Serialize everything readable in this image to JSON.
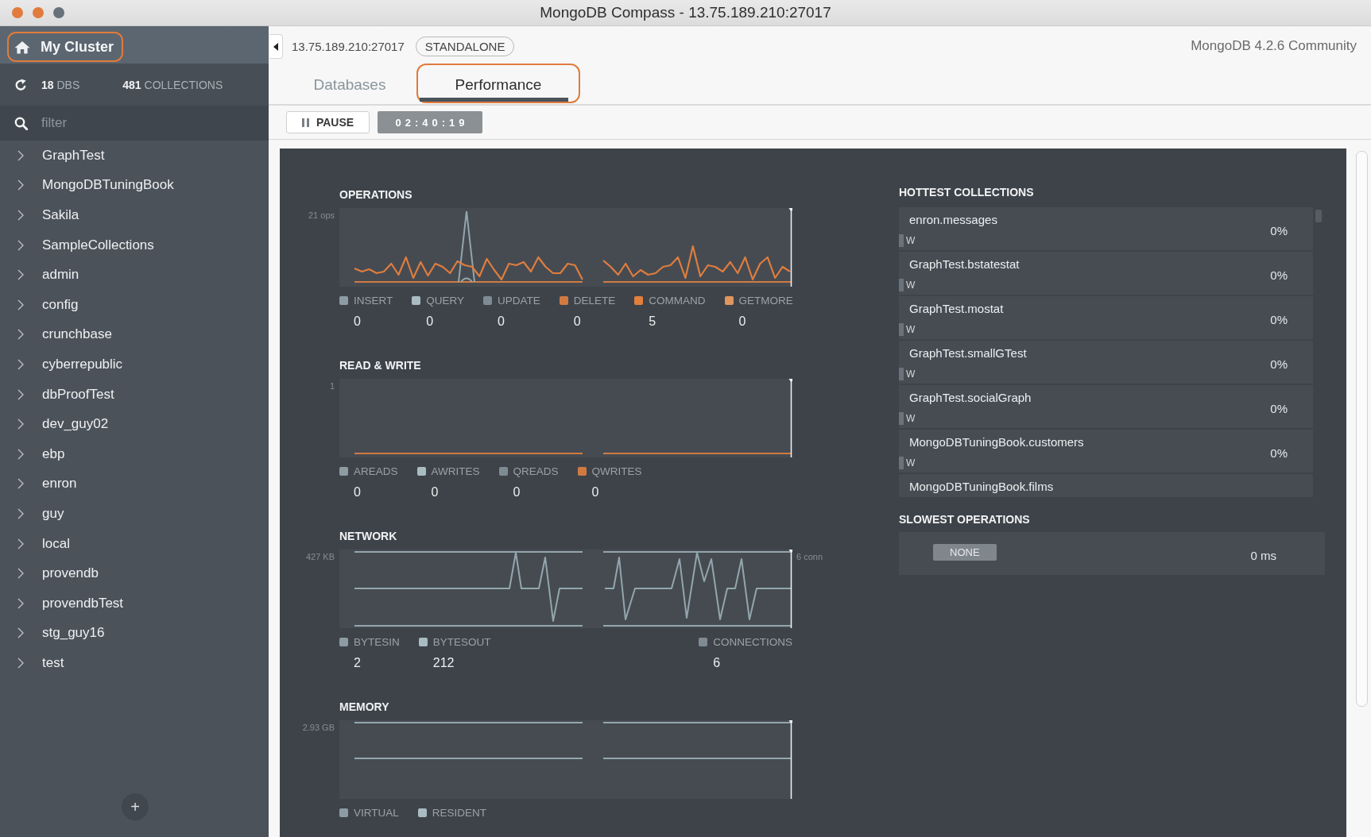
{
  "window": {
    "title": "MongoDB Compass - 13.75.189.210:27017"
  },
  "sidebar": {
    "cluster": {
      "label": "My Cluster",
      "highlighted": true
    },
    "stats": [
      {
        "count": "18",
        "unit": "DBS"
      },
      {
        "count": "481",
        "unit": "COLLECTIONS"
      }
    ],
    "filter": {
      "placeholder": "filter"
    },
    "databases": [
      {
        "name": "GraphTest",
        "expanded": false
      },
      {
        "name": "MongoDBTuningBook",
        "expanded": false
      },
      {
        "name": "Sakila",
        "expanded": false
      },
      {
        "name": "SampleCollections",
        "expanded": false
      },
      {
        "name": "admin",
        "expanded": false
      },
      {
        "name": "config",
        "expanded": false
      },
      {
        "name": "crunchbase",
        "expanded": false
      },
      {
        "name": "cyberrepublic",
        "expanded": false
      },
      {
        "name": "dbProofTest",
        "expanded": false
      },
      {
        "name": "dev_guy02",
        "expanded": false
      },
      {
        "name": "ebp",
        "expanded": false
      },
      {
        "name": "enron",
        "expanded": false
      },
      {
        "name": "guy",
        "expanded": false
      },
      {
        "name": "local",
        "expanded": false
      },
      {
        "name": "provendb",
        "expanded": false
      },
      {
        "name": "provendbTest",
        "expanded": false
      },
      {
        "name": "stg_guy16",
        "expanded": false
      },
      {
        "name": "test",
        "expanded": false
      }
    ],
    "add_button": {
      "label": "+"
    }
  },
  "header": {
    "address": "13.75.189.210:27017",
    "topology": "STANDALONE",
    "version": "MongoDB 4.2.6 Community"
  },
  "tabs": [
    {
      "label": "Databases",
      "selected": false,
      "highlighted": false
    },
    {
      "label": "Performance",
      "selected": true,
      "highlighted": true
    }
  ],
  "controls": {
    "pause_label": "PAUSE",
    "elapsed": "02:40:19"
  },
  "charts": [
    {
      "kind": "operations",
      "title": "OPERATIONS",
      "y_label": "21 ops",
      "legend": [
        {
          "label": "INSERT",
          "value": "0",
          "color": "#8d9ca3"
        },
        {
          "label": "QUERY",
          "value": "0",
          "color": "#a9bcc1"
        },
        {
          "label": "UPDATE",
          "value": "0",
          "color": "#7f8b93"
        },
        {
          "label": "DELETE",
          "value": "0",
          "color": "#d07a42"
        },
        {
          "label": "COMMAND",
          "value": "5",
          "color": "#e37f3c"
        },
        {
          "label": "GETMORE",
          "value": "0",
          "color": "#e0965e"
        }
      ]
    },
    {
      "kind": "readwrite",
      "title": "READ & WRITE",
      "y_label": "1",
      "legend": [
        {
          "label": "AREADS",
          "value": "0",
          "color": "#8d9ca3"
        },
        {
          "label": "AWRITES",
          "value": "0",
          "color": "#a9bcc1"
        },
        {
          "label": "QREADS",
          "value": "0",
          "color": "#7f8b93"
        },
        {
          "label": "QWRITES",
          "value": "0",
          "color": "#d07a42"
        }
      ]
    },
    {
      "kind": "network",
      "title": "NETWORK",
      "y_label": "427 KB",
      "y2_label": "6 conn",
      "legend": [
        {
          "label": "BYTESIN",
          "value": "2",
          "color": "#8d9ca3"
        },
        {
          "label": "BYTESOUT",
          "value": "212",
          "color": "#a9bcc1"
        }
      ],
      "legend_y2": [
        {
          "label": "CONNECTIONS",
          "value": "6",
          "color": "#7f8b93"
        }
      ]
    },
    {
      "kind": "memory",
      "title": "MEMORY",
      "y_label": "2.93 GB",
      "legend": [
        {
          "label": "VIRTUAL",
          "color": "#8d9ca3"
        },
        {
          "label": "RESIDENT",
          "color": "#a9bcc1"
        }
      ]
    }
  ],
  "hottest_collections": {
    "title": "HOTTEST COLLECTIONS",
    "rows": [
      {
        "name": "enron.messages",
        "load_label": "W",
        "level": 0,
        "percent": "0%"
      },
      {
        "name": "GraphTest.bstatestat",
        "load_label": "W",
        "level": 0,
        "percent": "0%"
      },
      {
        "name": "GraphTest.mostat",
        "load_label": "W",
        "level": 0,
        "percent": "0%"
      },
      {
        "name": "GraphTest.smallGTest",
        "load_label": "W",
        "level": 0,
        "percent": "0%"
      },
      {
        "name": "GraphTest.socialGraph",
        "load_label": "W",
        "level": 0,
        "percent": "0%"
      },
      {
        "name": "MongoDBTuningBook.customers",
        "load_label": "W",
        "level": 0,
        "percent": "0%"
      },
      {
        "name": "MongoDBTuningBook.films"
      }
    ]
  },
  "slowest_operations": {
    "title": "SLOWEST OPERATIONS",
    "rows": [
      {
        "status": "NONE",
        "duration": "0 ms"
      }
    ]
  }
}
